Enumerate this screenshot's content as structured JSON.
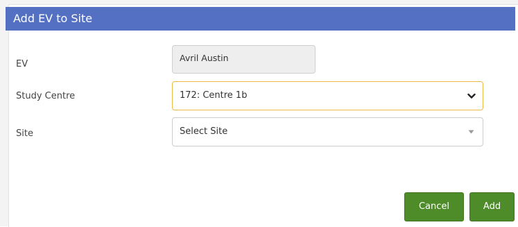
{
  "dialog": {
    "title": "Add EV to Site"
  },
  "form": {
    "ev": {
      "label": "EV",
      "value": "Avril Austin"
    },
    "study_centre": {
      "label": "Study Centre",
      "selected": "172: Centre 1b"
    },
    "site": {
      "label": "Site",
      "placeholder": "Select Site"
    }
  },
  "buttons": {
    "cancel": "Cancel",
    "add": "Add"
  },
  "colors": {
    "titlebar": "#5470c2",
    "button": "#4e8c2a",
    "focus_border": "#f0b84a"
  },
  "icons": {
    "study_centre_dropdown": "chevron-down-icon",
    "site_dropdown": "caret-down-icon"
  }
}
